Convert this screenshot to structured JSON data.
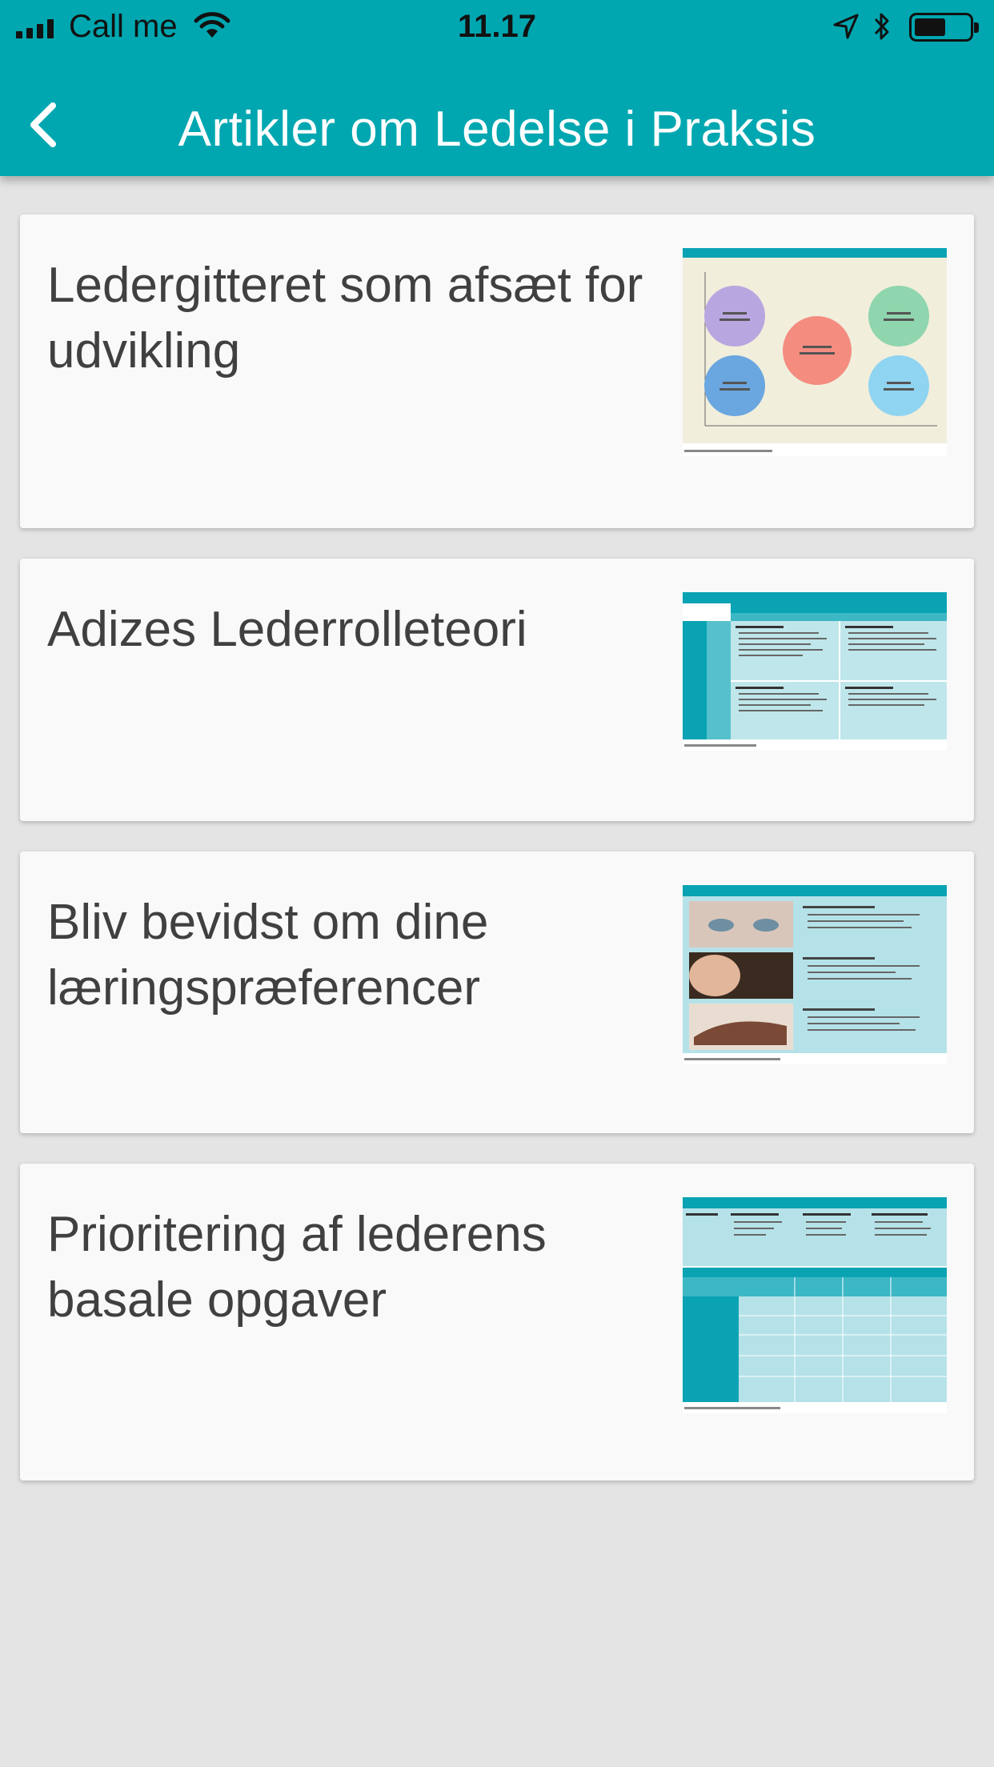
{
  "status_bar": {
    "carrier": "Call me",
    "time": "11.17"
  },
  "header": {
    "title": "Artikler om Ledelse i Praksis"
  },
  "articles": [
    {
      "title": "Ledergitteret som afsæt for udvikling",
      "thumbnail": "grid-diagram"
    },
    {
      "title": "Adizes Lederrolleteori",
      "thumbnail": "role-table"
    },
    {
      "title": "Bliv bevidst om dine læringspræferencer",
      "thumbnail": "learning-preferences"
    },
    {
      "title": "Prioritering af lederens basale opgaver",
      "thumbnail": "task-table"
    }
  ],
  "colors": {
    "header": "#00a7b0",
    "background": "#e4e4e4",
    "card": "#f9f9f9",
    "title_text": "#404040"
  }
}
